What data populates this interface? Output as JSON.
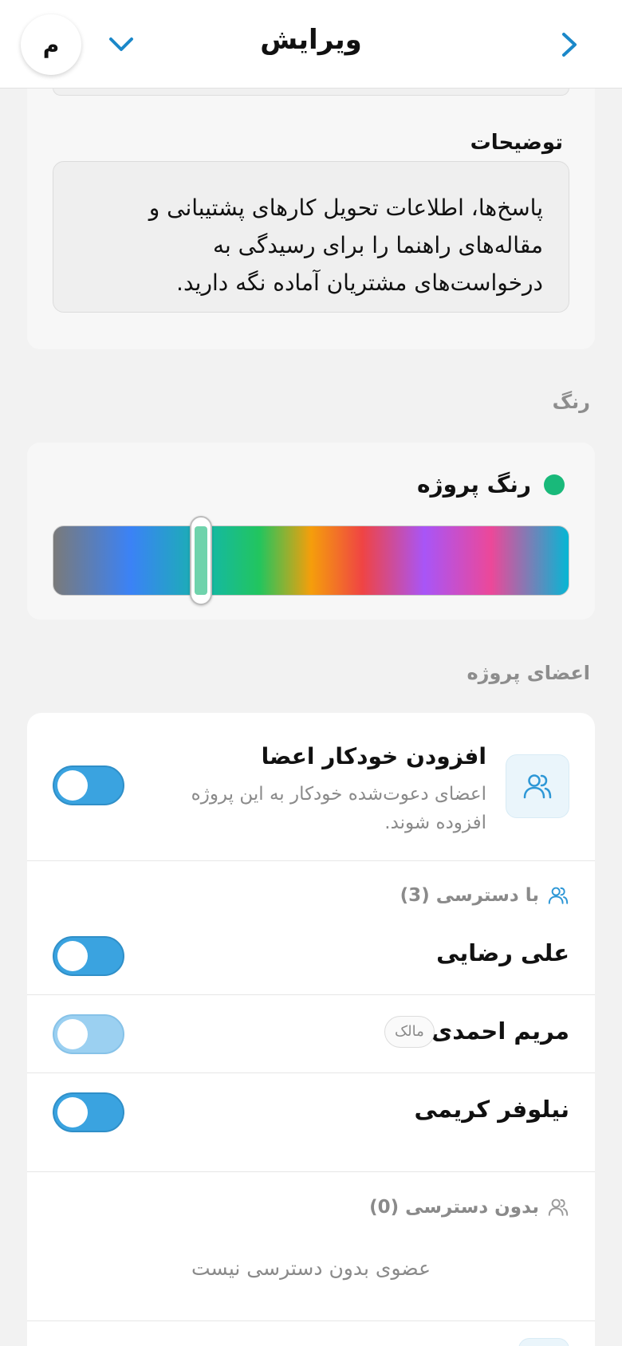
{
  "header": {
    "title": "ویرایش",
    "avatar_initial": "م"
  },
  "description": {
    "label": "توضیحات",
    "text": "پاسخ‌ها، اطلاعات تحویل کارهای پشتیبانی و مقاله‌های راهنما را برای رسیدگی به درخواست‌های مشتریان آماده نگه دارید."
  },
  "color_section": {
    "label": "رنگ",
    "title": "رنگ پروژه",
    "selected_color": "#19b97a",
    "slider_position": 0.27
  },
  "members_section": {
    "label": "اعضای پروژه",
    "auto_add": {
      "title": "افزودن خودکار اعضا",
      "description": "اعضای دعوت‌شده خودکار به این پروژه افزوده شوند.",
      "enabled": false
    },
    "with_access": {
      "label": "با دسترسی (3)",
      "members": [
        {
          "name": "علی رضایی",
          "badge": "",
          "enabled": false
        },
        {
          "name": "مریم احمدی",
          "badge": "مالک",
          "enabled": false,
          "disabled": true
        },
        {
          "name": "نیلوفر کریمی",
          "badge": "",
          "enabled": false
        }
      ]
    },
    "without_access": {
      "label": "بدون دسترسی (0)",
      "empty_text": "عضوی بدون دسترسی نیست"
    }
  },
  "colors": {
    "accent": "#3aa3e0",
    "back_chevron": "#1b88c9"
  }
}
